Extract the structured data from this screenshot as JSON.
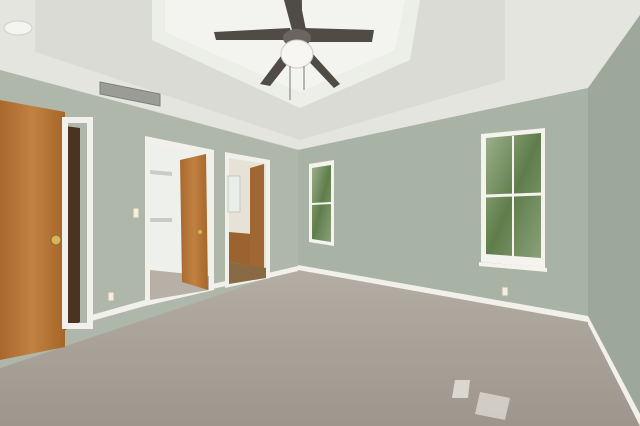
{
  "scene": {
    "colors": {
      "wall": "#a9b3a6",
      "wall_light": "#b5bdb1",
      "wall_right": "#9ea89b",
      "ceiling": "#e7e8e2",
      "carpet": "#a9a197",
      "trim": "#f1f0ea",
      "wood_door": "#b5773a",
      "wood_dark": "#8a5426",
      "fan_blade": "#4f4a46",
      "window_glass": "#6f8a5a",
      "closet_interior": "#eef0ec",
      "cabinet": "#9a6330"
    },
    "icons": [
      "ceiling-fan-icon",
      "door-knob-icon",
      "outlet-icon",
      "light-switch-icon",
      "air-vent-icon"
    ]
  }
}
